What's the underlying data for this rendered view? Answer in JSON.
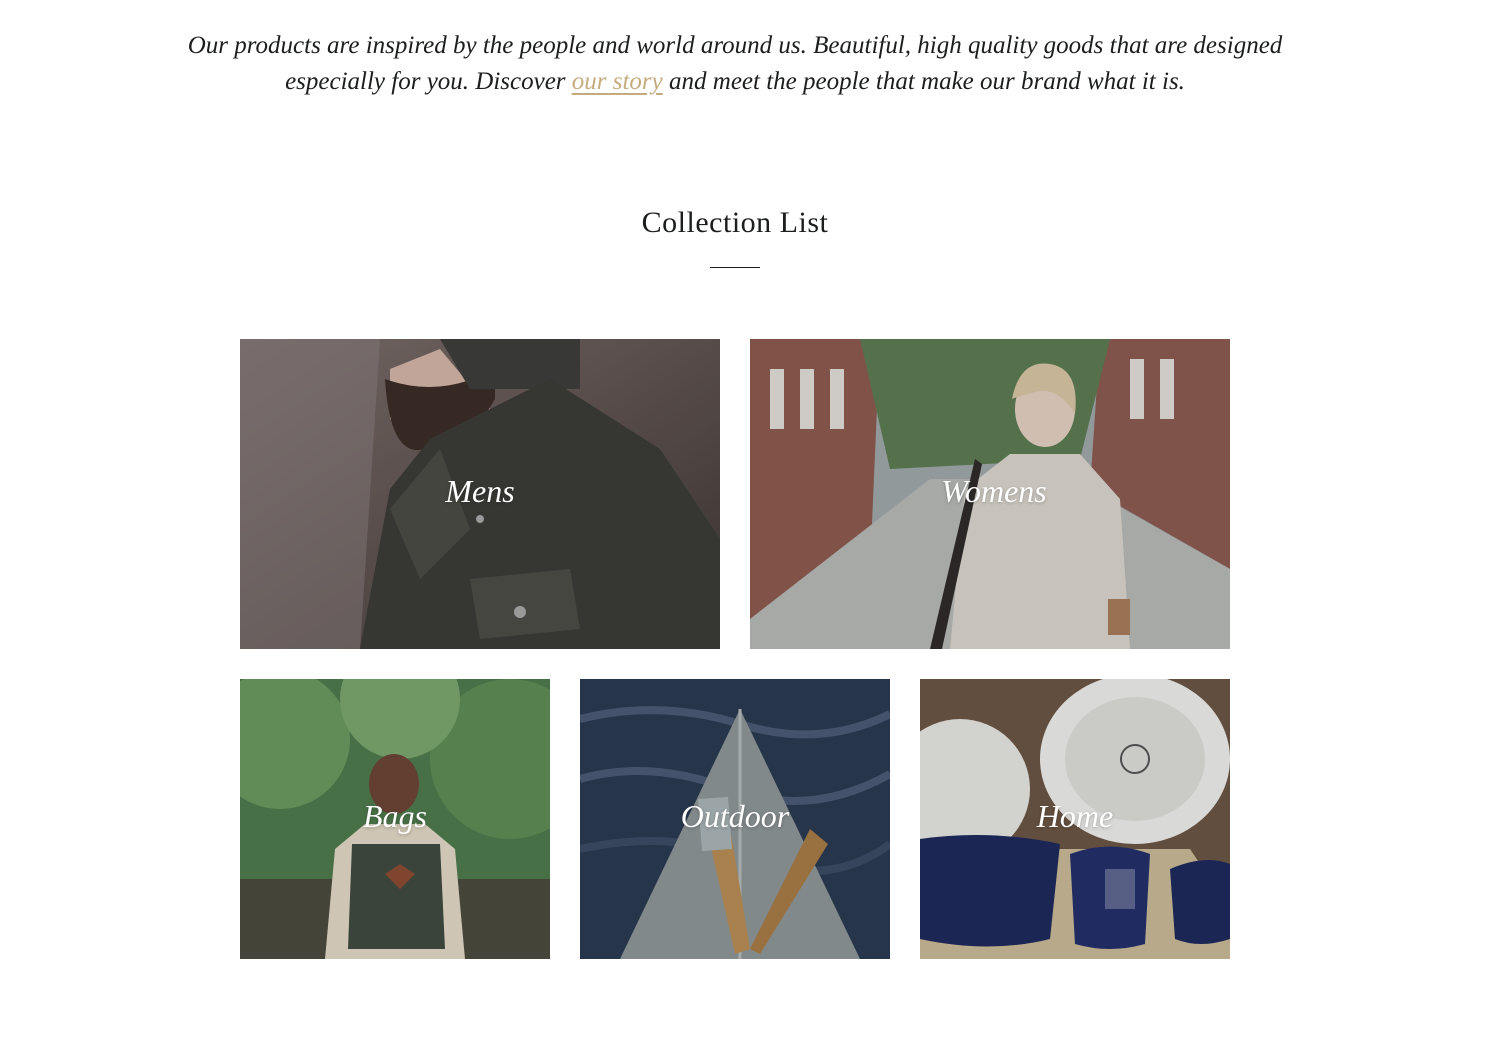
{
  "intro": {
    "text_before": "Our products are inspired by the people and world around us. Beautiful, high quality goods that are designed especially for you. Discover ",
    "link_text": "our story",
    "text_after": " and meet the people that make our brand what it is."
  },
  "collection": {
    "title": "Collection List",
    "items": [
      {
        "label": "Mens",
        "image": "man-in-beanie-and-quilted-jacket"
      },
      {
        "label": "Womens",
        "image": "woman-walking-brick-street-with-coffee"
      },
      {
        "label": "Bags",
        "image": "man-with-backpack-in-forest"
      },
      {
        "label": "Outdoor",
        "image": "canoe-bow-with-paddles"
      },
      {
        "label": "Home",
        "image": "enamel-plates-and-mugs"
      }
    ]
  },
  "colors": {
    "text": "#1c1d1d",
    "link": "#c5ac7f",
    "label": "#ffffff"
  }
}
